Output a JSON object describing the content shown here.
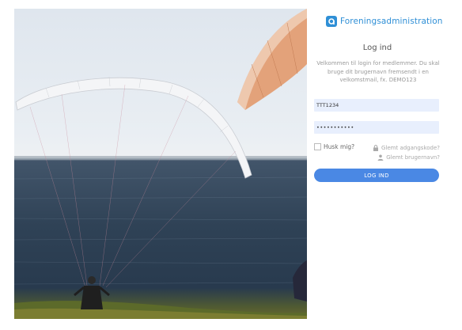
{
  "brand": {
    "name": "Foreningsadministration",
    "logo_icon": "a-logo-icon",
    "color": "#2f8fd6"
  },
  "login": {
    "title": "Log ind",
    "intro": "Velkommen til login for medlemmer. Du skal bruge dit brugernavn fremsendt i en velkomstmail, fx. DEMO123",
    "username_value": "TTT1234",
    "password_value": "•••••••••••",
    "remember_label": "Husk mig?",
    "forgot_password": "Glemt adgangskode?",
    "forgot_username": "Glemt brugernavn?",
    "submit_label": "LOG IND"
  },
  "colors": {
    "accent": "#4a88e4",
    "field_bg": "#e8effd"
  }
}
